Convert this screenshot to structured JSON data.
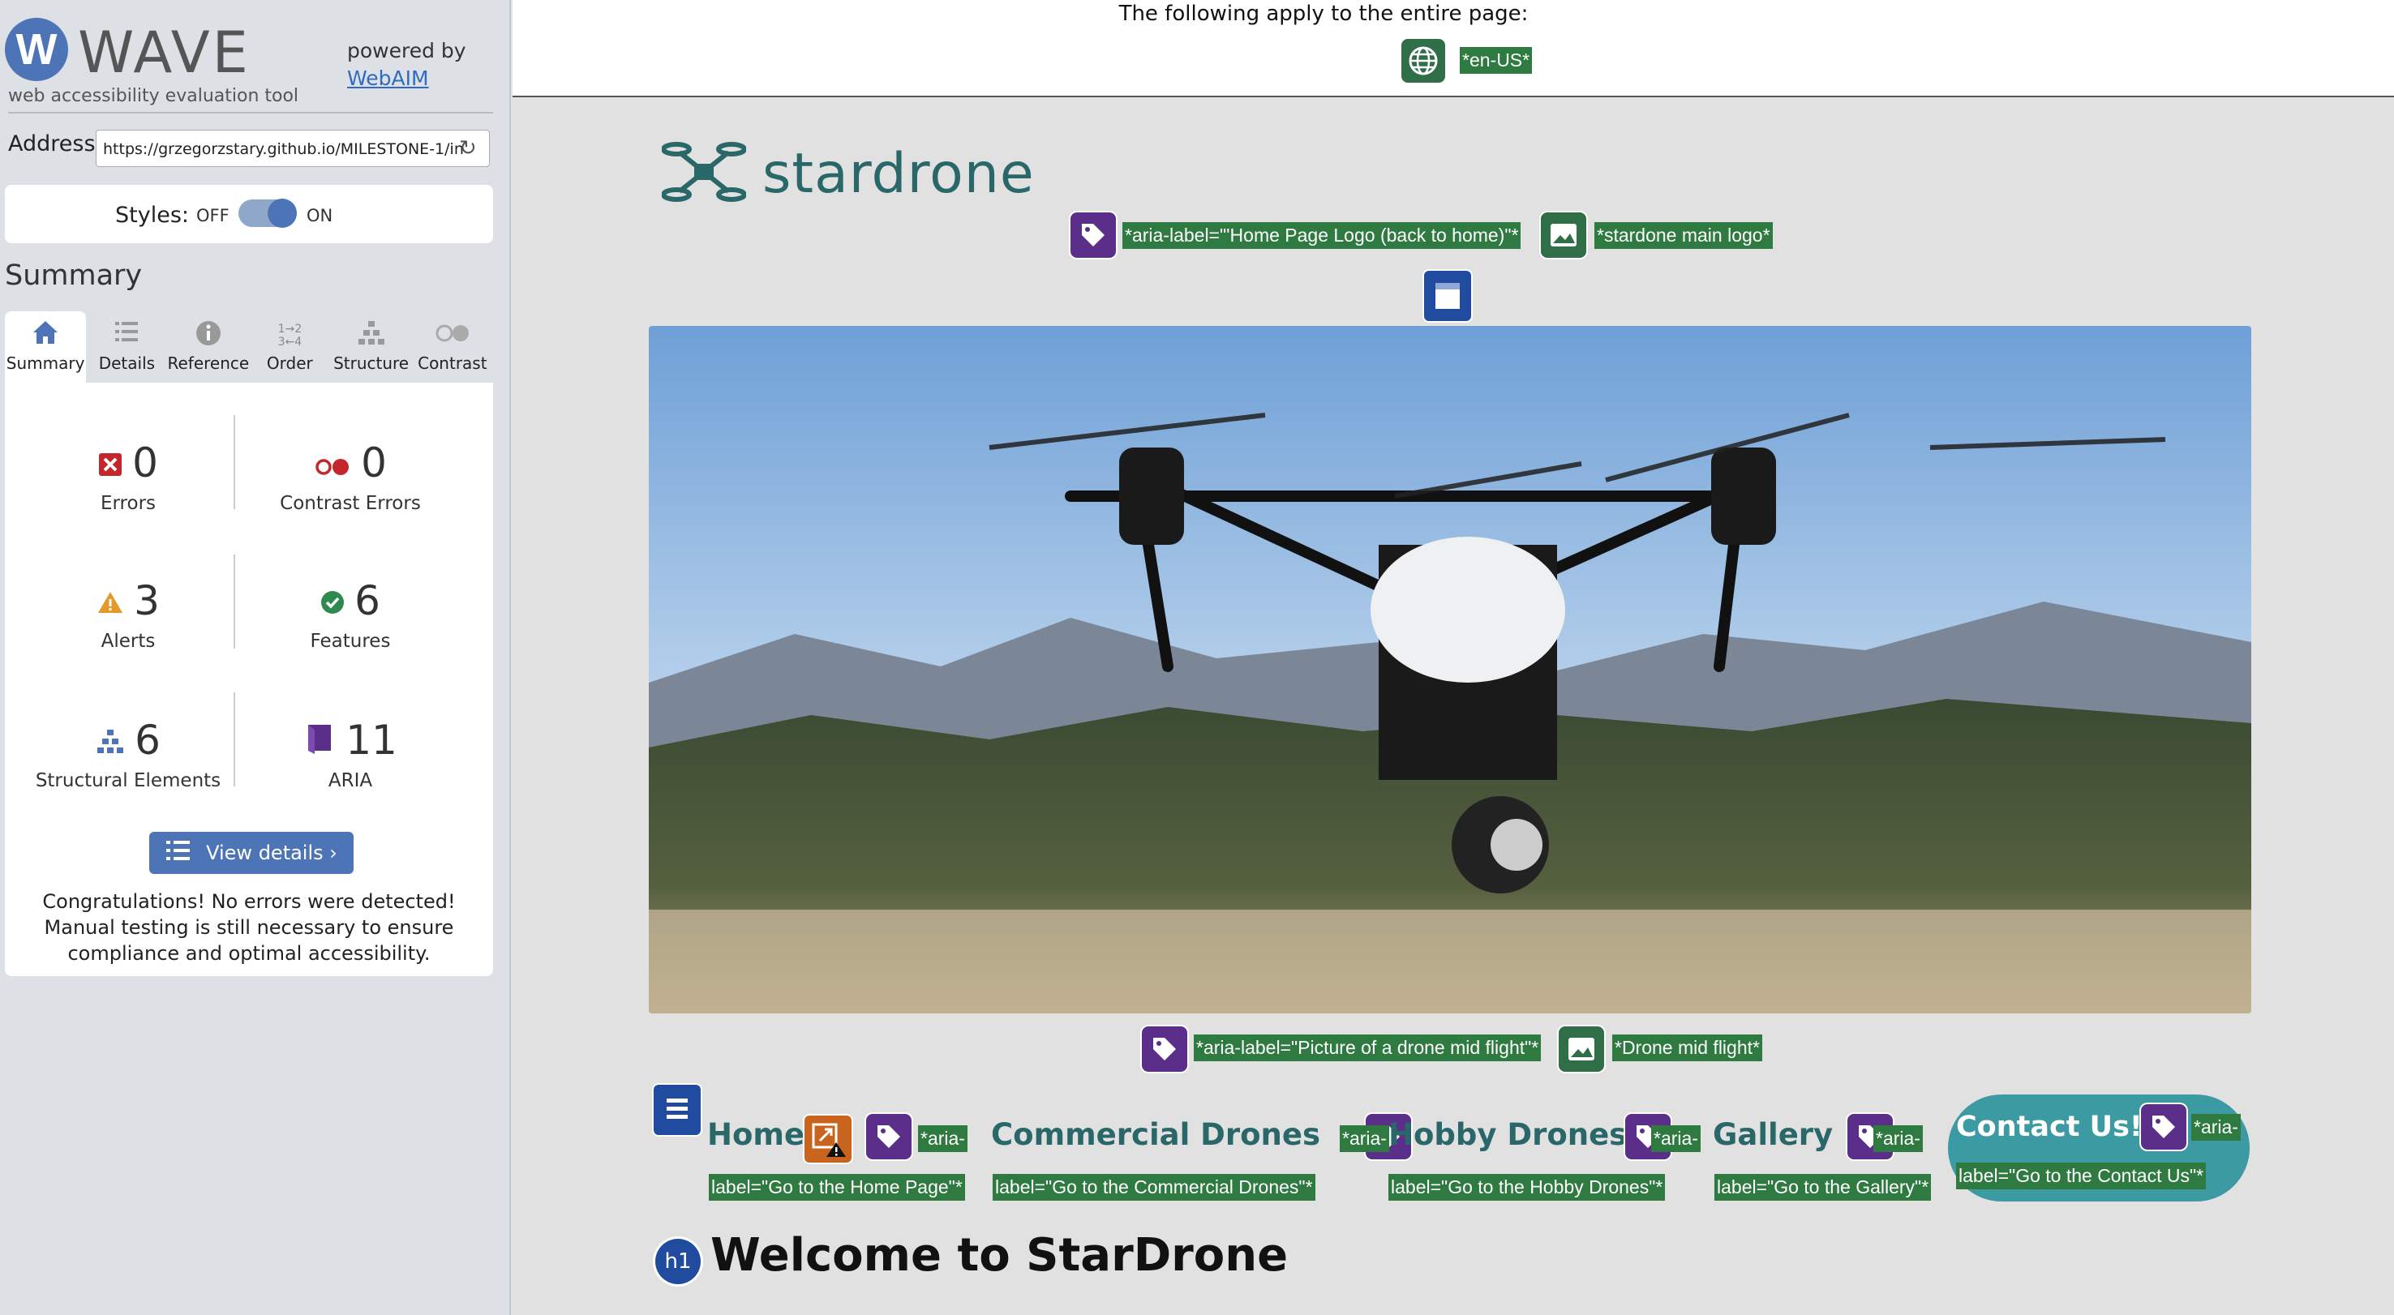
{
  "wave": {
    "logo_letter": "W",
    "title": "WAVE",
    "subtitle": "web accessibility evaluation tool",
    "powered_by": "powered by",
    "webaim_link": "WebAIM",
    "address_label": "Address:",
    "address_value": "https://grzegorzstary.github.io/MILESTONE-1/in",
    "styles_label": "Styles:",
    "styles_off": "OFF",
    "styles_on": "ON",
    "styles_state": "on"
  },
  "summary": {
    "heading": "Summary",
    "tabs": [
      {
        "label": "Summary",
        "icon": "home-icon",
        "active": true
      },
      {
        "label": "Details",
        "icon": "list-icon"
      },
      {
        "label": "Reference",
        "icon": "info-icon"
      },
      {
        "label": "Order",
        "icon": "order-icon"
      },
      {
        "label": "Structure",
        "icon": "structure-icon"
      },
      {
        "label": "Contrast",
        "icon": "contrast-icon"
      }
    ],
    "stats": {
      "errors": {
        "value": "0",
        "label": "Errors"
      },
      "contrast_errors": {
        "value": "0",
        "label": "Contrast Errors"
      },
      "alerts": {
        "value": "3",
        "label": "Alerts"
      },
      "features": {
        "value": "6",
        "label": "Features"
      },
      "structural": {
        "value": "6",
        "label": "Structural Elements"
      },
      "aria": {
        "value": "11",
        "label": "ARIA"
      }
    },
    "view_details": "View details ›",
    "congrats": "Congratulations! No errors were detected! Manual testing is still necessary to ensure compliance and optimal accessibility."
  },
  "page": {
    "top_note": "The following apply to the entire page:",
    "lang_tag": "*en-US*",
    "logo_text": "stardrone",
    "logo_aria_tag": "*aria-label=\"'Home Page Logo (back to home)\"*",
    "logo_alt_tag": "*stardone main logo*",
    "hero_aria_tag": "*aria-label=\"Picture of a drone mid flight\"*",
    "hero_alt_tag": "*Drone mid flight*",
    "nav": [
      {
        "label": "Home",
        "tag_a": "*aria-",
        "tag_b": "label=\"Go to the Home Page\"*"
      },
      {
        "label": "Commercial Drones",
        "tag_a": "*aria-",
        "tag_b": "label=\"Go to the Commercial Drones\"*"
      },
      {
        "label": "Hobby Drones",
        "tag_a": "*aria-",
        "tag_b": "label=\"Go to the Hobby Drones\"*"
      },
      {
        "label": "Gallery",
        "tag_a": "*aria-",
        "tag_b": "label=\"Go to the Gallery\"*"
      },
      {
        "label": "Contact Us!",
        "tag_a": "*aria-",
        "tag_b": "label=\"Go to the Contact Us\"*"
      }
    ],
    "h1_badge": "h1",
    "heading": "Welcome to StarDrone"
  },
  "colors": {
    "wave_blue": "#4c74b6",
    "tag_green": "#2f7a40",
    "aria_purple": "#5b2e8a",
    "brand_teal": "#2a6768",
    "contact_pill": "#3b9aa2"
  }
}
